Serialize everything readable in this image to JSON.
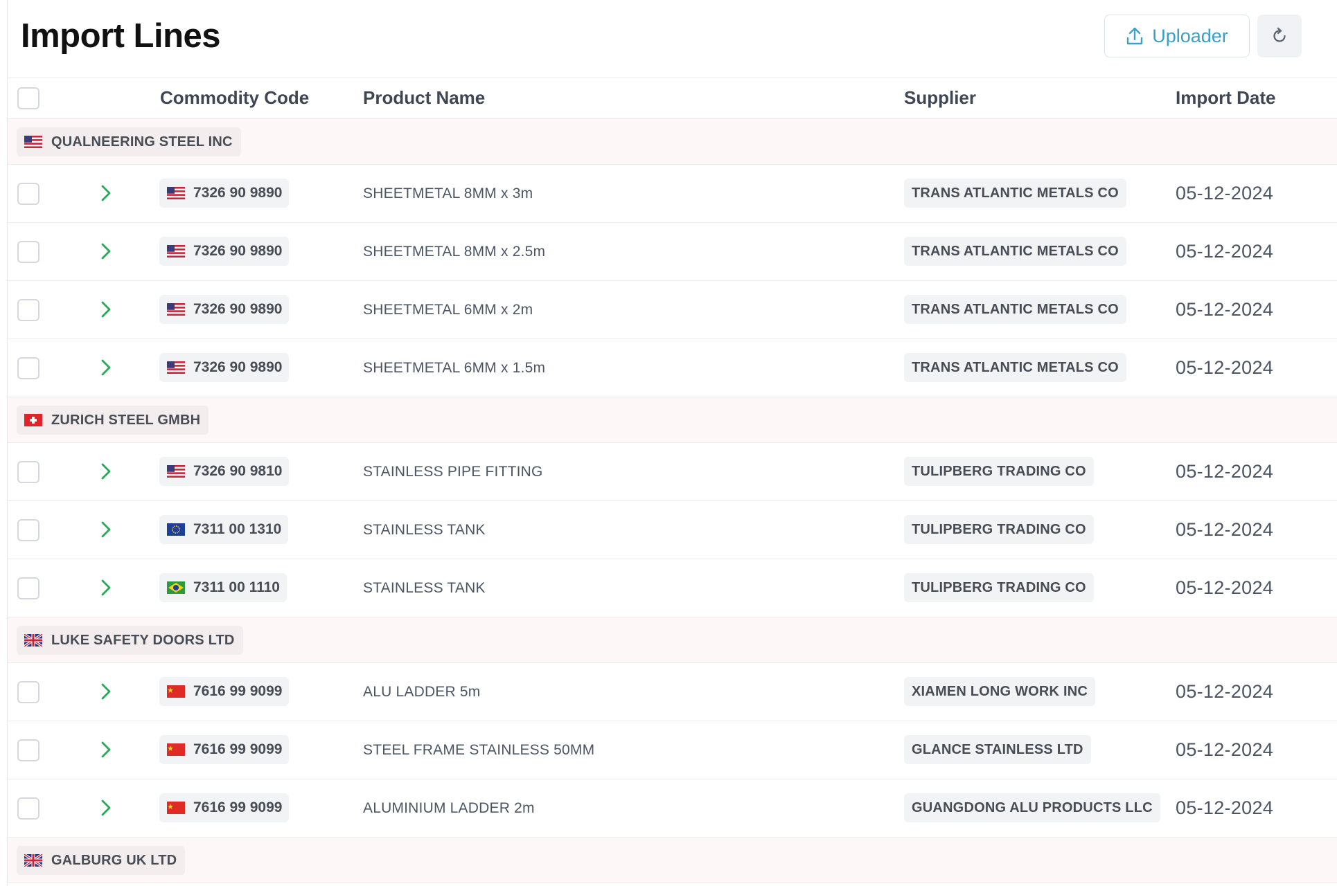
{
  "page": {
    "title": "Import Lines"
  },
  "toolbar": {
    "uploader_label": "Uploader",
    "refresh_icon": "refresh-icon",
    "upload_icon": "upload-icon"
  },
  "columns": {
    "commodity_code": "Commodity Code",
    "product_name": "Product Name",
    "supplier": "Supplier",
    "import_date": "Import Date"
  },
  "groups": [
    {
      "name": "QUALNEERING STEEL INC",
      "flag": "us",
      "rows": [
        {
          "flag": "us",
          "code": "7326 90 9890",
          "product": "SHEETMETAL 8MM x 3m",
          "supplier": "TRANS ATLANTIC METALS CO",
          "date": "05-12-2024"
        },
        {
          "flag": "us",
          "code": "7326 90 9890",
          "product": "SHEETMETAL 8MM x 2.5m",
          "supplier": "TRANS ATLANTIC METALS CO",
          "date": "05-12-2024"
        },
        {
          "flag": "us",
          "code": "7326 90 9890",
          "product": "SHEETMETAL 6MM x 2m",
          "supplier": "TRANS ATLANTIC METALS CO",
          "date": "05-12-2024"
        },
        {
          "flag": "us",
          "code": "7326 90 9890",
          "product": "SHEETMETAL 6MM x 1.5m",
          "supplier": "TRANS ATLANTIC METALS CO",
          "date": "05-12-2024"
        }
      ]
    },
    {
      "name": "ZURICH STEEL GMBH",
      "flag": "ch",
      "rows": [
        {
          "flag": "us",
          "code": "7326 90 9810",
          "product": "STAINLESS PIPE FITTING",
          "supplier": "TULIPBERG TRADING CO",
          "date": "05-12-2024"
        },
        {
          "flag": "eu",
          "code": "7311 00 1310",
          "product": "STAINLESS TANK",
          "supplier": "TULIPBERG TRADING CO",
          "date": "05-12-2024"
        },
        {
          "flag": "br",
          "code": "7311 00 1110",
          "product": "STAINLESS TANK",
          "supplier": "TULIPBERG TRADING CO",
          "date": "05-12-2024"
        }
      ]
    },
    {
      "name": "LUKE SAFETY DOORS LTD",
      "flag": "gb",
      "rows": [
        {
          "flag": "cn",
          "code": "7616 99 9099",
          "product": "ALU LADDER 5m",
          "supplier": "XIAMEN LONG WORK INC",
          "date": "05-12-2024"
        },
        {
          "flag": "cn",
          "code": "7616 99 9099",
          "product": "STEEL FRAME STAINLESS 50MM",
          "supplier": "GLANCE STAINLESS LTD",
          "date": "05-12-2024"
        },
        {
          "flag": "cn",
          "code": "7616 99 9099",
          "product": "ALUMINIUM LADDER 2m",
          "supplier": "GUANGDONG ALU PRODUCTS LLC",
          "date": "05-12-2024"
        }
      ]
    },
    {
      "name": "GALBURG UK LTD",
      "flag": "gb",
      "rows": []
    }
  ],
  "colors": {
    "accent": "#38a0c9",
    "chevron": "#2aa85a",
    "group_bg": "#fdf8f7"
  }
}
